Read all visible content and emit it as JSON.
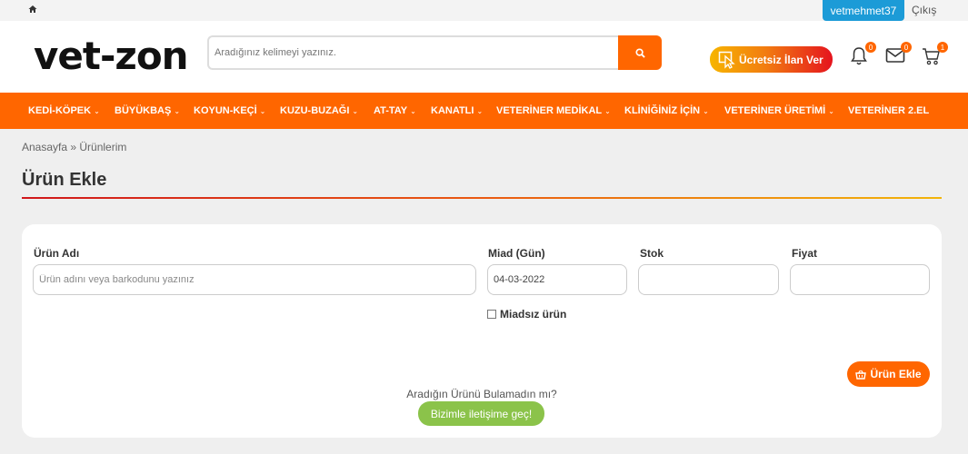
{
  "topbar": {
    "home_icon": "home-icon",
    "username": "vetmehmet37",
    "logout": "Çıkış"
  },
  "header": {
    "logo": "vet-zon",
    "search_placeholder": "Aradığınız kelimeyi yazınız.",
    "search_icon": "search-icon",
    "ad_button": "Ücretsiz İlan Ver",
    "notifications_count": "0",
    "messages_count": "0",
    "cart_count": "1"
  },
  "nav": {
    "items": [
      "KEDİ-KÖPEK",
      "BÜYÜKBAŞ",
      "KOYUN-KEÇİ",
      "KUZU-BUZAĞI",
      "AT-TAY",
      "KANATLI",
      "VETERİNER MEDİKAL",
      "KLİNİĞİNİZ İÇİN",
      "VETERİNER ÜRETİMİ",
      "VETERİNER 2.EL"
    ],
    "chevron": "⌄"
  },
  "breadcrumb": "Anasayfa » Ürünlerim",
  "page_title": "Ürün Ekle",
  "form": {
    "product_name_label": "Ürün Adı",
    "product_name_placeholder": "Ürün adını veya barkodunu yazınız",
    "expiry_label": "Miad (Gün)",
    "expiry_value": "04-03-2022",
    "stock_label": "Stok",
    "stock_value": "",
    "price_label": "Fiyat",
    "price_value": "",
    "no_expiry_label": "Miadsız ürün",
    "add_button": "Ürün Ekle",
    "not_found_text": "Aradığın Ürünü Bulamadın mı?",
    "contact_button": "Bizimle iletişime geç!"
  },
  "colors": {
    "accent": "#ff6600",
    "user_badge": "#1c9bd7",
    "contact_green": "#8bc34a"
  }
}
